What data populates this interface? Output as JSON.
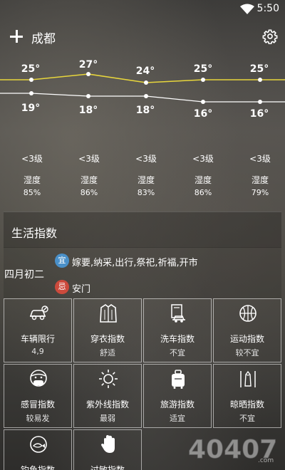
{
  "status_bar": {
    "time": "5:50"
  },
  "header": {
    "city": "成都"
  },
  "forecast": {
    "days": [
      {
        "high": "25°",
        "low": "19°",
        "wind": "<3级",
        "humidity_label": "湿度",
        "humidity": "85%"
      },
      {
        "high": "27°",
        "low": "18°",
        "wind": "<3级",
        "humidity_label": "湿度",
        "humidity": "86%"
      },
      {
        "high": "24°",
        "low": "18°",
        "wind": "<3级",
        "humidity_label": "湿度",
        "humidity": "83%"
      },
      {
        "high": "25°",
        "low": "16°",
        "wind": "<3级",
        "humidity_label": "湿度",
        "humidity": "86%"
      },
      {
        "high": "25°",
        "low": "16°",
        "wind": "<3级",
        "humidity_label": "湿度",
        "humidity": "79%"
      }
    ],
    "high_line_color": "#e8d63c",
    "low_line_color": "#ffffff"
  },
  "life": {
    "title": "生活指数",
    "lunar_date": "四月初二",
    "yi_badge": "宜",
    "yi_text": "嫁要,纳采,出行,祭祀,祈福,开市",
    "ji_badge": "忌",
    "ji_text": "安门",
    "yi_color": "#4a90c9",
    "ji_color": "#cc4a3c"
  },
  "indices": [
    {
      "icon": "car-icon",
      "name": "车辆限行",
      "value": "4,9"
    },
    {
      "icon": "coat-icon",
      "name": "穿衣指数",
      "value": "舒适"
    },
    {
      "icon": "car-wash-icon",
      "name": "洗车指数",
      "value": "不宜"
    },
    {
      "icon": "basketball-icon",
      "name": "运动指数",
      "value": "较不宜"
    },
    {
      "icon": "mask-icon",
      "name": "感冒指数",
      "value": "较易发"
    },
    {
      "icon": "sun-icon",
      "name": "紫外线指数",
      "value": "最弱"
    },
    {
      "icon": "luggage-icon",
      "name": "旅游指数",
      "value": "适宜"
    },
    {
      "icon": "drying-icon",
      "name": "晾晒指数",
      "value": "不宜"
    },
    {
      "icon": "fishing-icon",
      "name": "钓鱼指数",
      "value": ""
    },
    {
      "icon": "hand-icon",
      "name": "过敏指数",
      "value": ""
    }
  ],
  "watermark": {
    "text": "40407",
    "suffix": ".com"
  }
}
